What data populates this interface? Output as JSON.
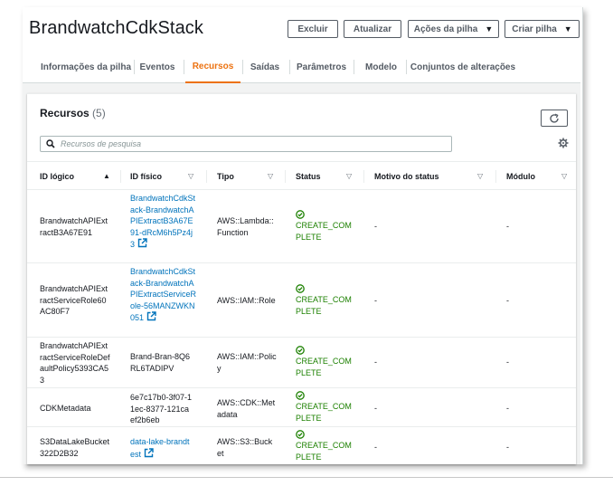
{
  "stack": {
    "title": "BrandwatchCdkStack",
    "buttons": {
      "delete": "Excluir",
      "update": "Atualizar",
      "actions": "Ações da pilha",
      "create": "Criar pilha"
    }
  },
  "tabs": [
    {
      "label": "Informações da pilha",
      "active": false
    },
    {
      "label": "Eventos",
      "active": false
    },
    {
      "label": "Recursos",
      "active": true
    },
    {
      "label": "Saídas",
      "active": false
    },
    {
      "label": "Parâmetros",
      "active": false
    },
    {
      "label": "Modelo",
      "active": false
    },
    {
      "label": "Conjuntos de alterações",
      "active": false
    }
  ],
  "resources": {
    "title": "Recursos",
    "count": "(5)",
    "search_placeholder": "Recursos de pesquisa",
    "columns": [
      "ID lógico",
      "ID físico",
      "Tipo",
      "Status",
      "Motivo do status",
      "Módulo"
    ],
    "rows": [
      {
        "logical_id": "BrandwatchAPIExtractB3A67E91",
        "physical_id": "BrandwatchCdkStack-BrandwatchAPIExtractB3A67E91-dRcM6h5Pz4j3",
        "physical_is_link": true,
        "type": "AWS::Lambda::Function",
        "status": "CREATE_COMPLETE",
        "reason": "-",
        "module": "-"
      },
      {
        "logical_id": "BrandwatchAPIExtractServiceRole60AC80F7",
        "physical_id": "BrandwatchCdkStack-BrandwatchAPIExtractServiceRole-56MANZWKN051",
        "physical_is_link": true,
        "type": "AWS::IAM::Role",
        "status": "CREATE_COMPLETE",
        "reason": "-",
        "module": "-"
      },
      {
        "logical_id": "BrandwatchAPIExtractServiceRoleDefaultPolicy5393CA53",
        "physical_id": "Brand-Bran-8Q6RL6TADIPV",
        "physical_is_link": false,
        "type": "AWS::IAM::Policy",
        "status": "CREATE_COMPLETE",
        "reason": "-",
        "module": "-"
      },
      {
        "logical_id": "CDKMetadata",
        "physical_id": "6e7c17b0-3f07-11ec-8377-121caef2b6eb",
        "physical_is_link": false,
        "type": "AWS::CDK::Metadata",
        "status": "CREATE_COMPLETE",
        "reason": "-",
        "module": "-"
      },
      {
        "logical_id": "S3DataLakeBucket322D2B32",
        "physical_id": "data-lake-brandtest",
        "physical_is_link": true,
        "type": "AWS::S3::Bucket",
        "status": "CREATE_COMPLETE",
        "reason": "-",
        "module": "-"
      }
    ]
  },
  "icons": {
    "refresh": "refresh-icon",
    "search": "search-icon",
    "settings": "gear-icon",
    "status_ok": "check-circle-icon",
    "external": "external-link-icon"
  },
  "colors": {
    "accent": "#ec7211",
    "link": "#0073bb",
    "success": "#1d8102"
  }
}
